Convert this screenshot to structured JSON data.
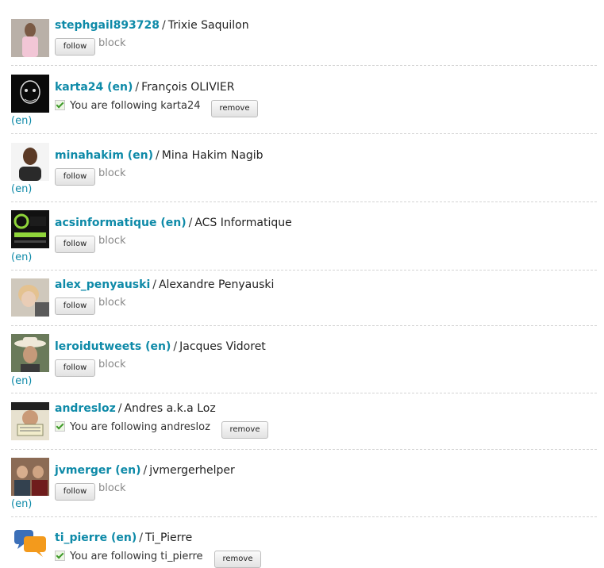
{
  "labels": {
    "follow": "follow",
    "block": "block",
    "remove": "remove",
    "following_prefix": "You are following",
    "separator": "/",
    "lang": "(en)"
  },
  "users": [
    {
      "username": "stephgail893728",
      "realname": "Trixie Saquilon",
      "following": false,
      "follow_text": "",
      "lang": ""
    },
    {
      "username": "karta24 (en)",
      "realname": "François OLIVIER",
      "following": true,
      "follow_text": "You are following karta24",
      "lang": "(en)"
    },
    {
      "username": "minahakim (en)",
      "realname": "Mina Hakim Nagib",
      "following": false,
      "follow_text": "",
      "lang": "(en)"
    },
    {
      "username": "acsinformatique (en)",
      "realname": "ACS Informatique",
      "following": false,
      "follow_text": "",
      "lang": "(en)"
    },
    {
      "username": "alex_penyauski",
      "realname": "Alexandre Penyauski",
      "following": false,
      "follow_text": "",
      "lang": ""
    },
    {
      "username": "leroidutweets (en)",
      "realname": "Jacques Vidoret",
      "following": false,
      "follow_text": "",
      "lang": "(en)"
    },
    {
      "username": "andresloz",
      "realname": "Andres a.k.a Loz",
      "following": true,
      "follow_text": "You are following andresloz",
      "lang": ""
    },
    {
      "username": "jvmerger (en)",
      "realname": "jvmergerhelper",
      "following": false,
      "follow_text": "",
      "lang": "(en)"
    },
    {
      "username": "ti_pierre (en)",
      "realname": "Ti_Pierre",
      "following": true,
      "follow_text": "You are following ti_pierre",
      "lang": ""
    }
  ]
}
